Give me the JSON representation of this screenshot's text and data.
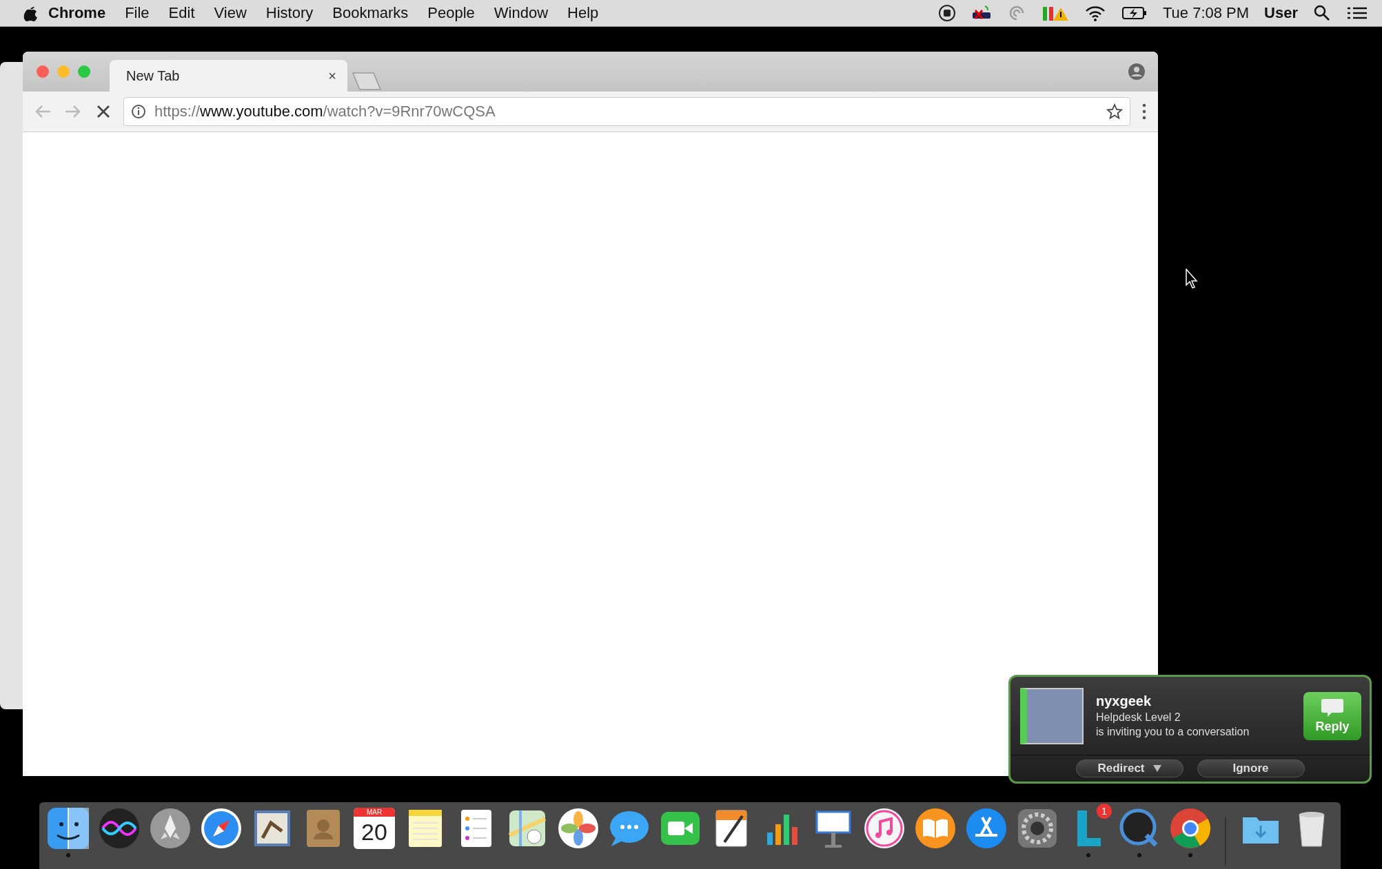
{
  "menu_bar": {
    "app_name": "Chrome",
    "menus": [
      "File",
      "Edit",
      "View",
      "History",
      "Bookmarks",
      "People",
      "Window",
      "Help"
    ],
    "clock": "Tue 7:08 PM",
    "user": "User"
  },
  "browser": {
    "tabs": [
      {
        "title": "New Tab",
        "selected": true,
        "close": "×"
      }
    ],
    "toolbar": {
      "back_disabled": true,
      "forward_disabled": true,
      "loading": true
    },
    "address": {
      "scheme": "https://",
      "host": "www.youtube.com",
      "path": "/watch?v=9Rnr70wCQSA"
    }
  },
  "notification": {
    "name": "nyxgeek",
    "subtitle": "Helpdesk Level 2",
    "message": "is inviting you to a conversation",
    "reply": "Reply",
    "redirect": "Redirect",
    "ignore": "Ignore"
  },
  "dock": {
    "apps": [
      {
        "kind": "finder",
        "running": true
      },
      {
        "kind": "siri",
        "running": false
      },
      {
        "kind": "launchpad",
        "running": false
      },
      {
        "kind": "safari",
        "running": false
      },
      {
        "kind": "mail",
        "running": false
      },
      {
        "kind": "contacts",
        "running": false
      },
      {
        "kind": "calendar",
        "running": false,
        "month": "MAR",
        "day": "20"
      },
      {
        "kind": "notes",
        "running": false
      },
      {
        "kind": "reminders",
        "running": false
      },
      {
        "kind": "maps",
        "running": false
      },
      {
        "kind": "photos",
        "running": false
      },
      {
        "kind": "messages",
        "running": false
      },
      {
        "kind": "facetime",
        "running": false
      },
      {
        "kind": "pages",
        "running": false
      },
      {
        "kind": "numbers",
        "running": false
      },
      {
        "kind": "keynote",
        "running": false
      },
      {
        "kind": "itunes",
        "running": false
      },
      {
        "kind": "ibooks",
        "running": false
      },
      {
        "kind": "appstore",
        "running": false
      },
      {
        "kind": "preferences",
        "running": false
      },
      {
        "kind": "lync",
        "running": true,
        "badge": "1"
      },
      {
        "kind": "quicktime",
        "running": true
      },
      {
        "kind": "chrome",
        "running": true
      }
    ],
    "stacks": [
      {
        "kind": "downloads"
      },
      {
        "kind": "trash"
      }
    ]
  }
}
